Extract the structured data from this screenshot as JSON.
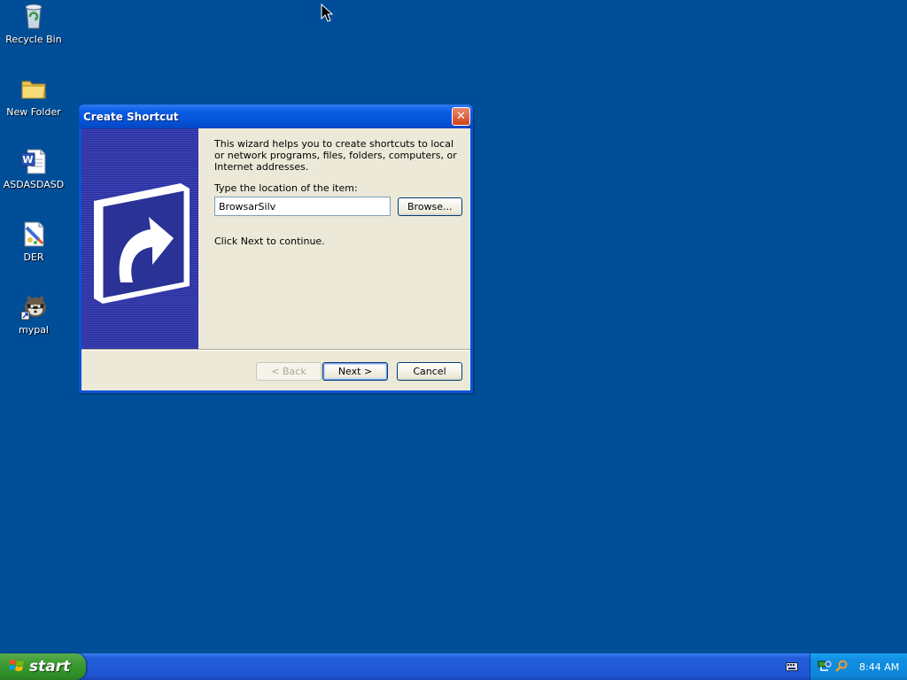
{
  "desktop": {
    "icons": [
      {
        "label": "Recycle Bin",
        "icon": "recycle-bin-icon"
      },
      {
        "label": "New Folder",
        "icon": "folder-icon"
      },
      {
        "label": "ASDASDASD",
        "icon": "word-document-icon"
      },
      {
        "label": "DER",
        "icon": "paint-image-icon"
      },
      {
        "label": "mypal",
        "icon": "mypal-browser-icon"
      }
    ]
  },
  "dialog": {
    "title": "Create Shortcut",
    "intro": "This wizard helps you to create shortcuts to local or network programs, files, folders, computers, or Internet addresses.",
    "location_label": "Type the location of the item:",
    "location_value": "BrowsarSilv",
    "browse_label": "Browse...",
    "continue_text": "Click Next to continue.",
    "back_label": "< Back",
    "next_label": "Next >",
    "cancel_label": "Cancel",
    "close_glyph": "✕"
  },
  "taskbar": {
    "start_label": "start",
    "clock": "8:44 AM"
  },
  "colors": {
    "desktop": "#004e98",
    "titlebar": "#0453d6",
    "dialog_face": "#ece9d8",
    "taskbar": "#245edb",
    "start_button": "#3c9a33",
    "tray": "#0f86d8"
  }
}
